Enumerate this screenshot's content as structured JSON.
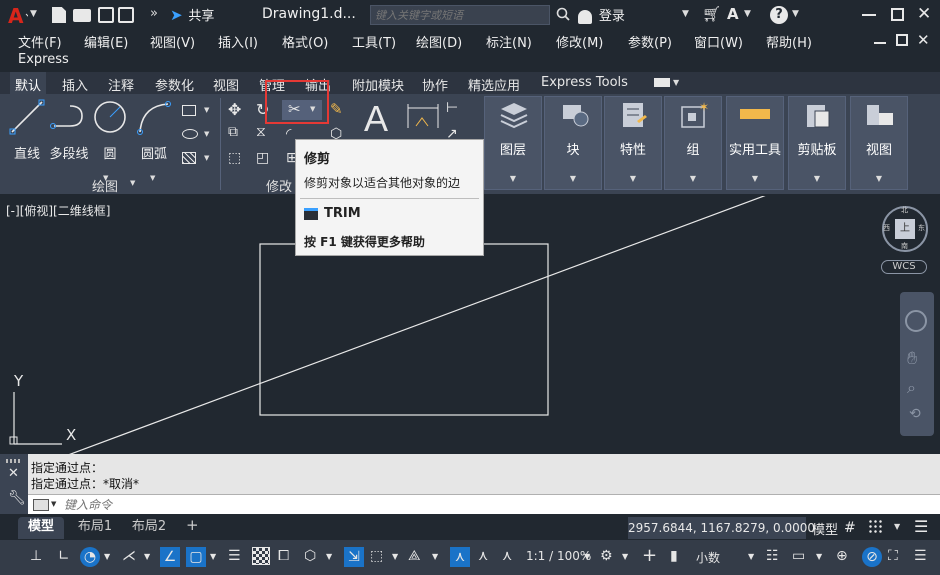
{
  "title_bar": {
    "share_label": "共享",
    "document_title": "Drawing1.d...",
    "search_placeholder": "键入关键字或短语",
    "login_label": "登录"
  },
  "menus": [
    "文件(F)",
    "编辑(E)",
    "视图(V)",
    "插入(I)",
    "格式(O)",
    "工具(T)",
    "绘图(D)",
    "标注(N)",
    "修改(M)",
    "参数(P)",
    "窗口(W)",
    "帮助(H)"
  ],
  "menu_extra": "Express",
  "ribbon_tabs": [
    "默认",
    "插入",
    "注释",
    "参数化",
    "视图",
    "管理",
    "输出",
    "附加模块",
    "协作",
    "精选应用",
    "Express Tools"
  ],
  "draw_panel": {
    "tools": [
      "直线",
      "多段线",
      "圆",
      "圆弧"
    ],
    "label": "绘图"
  },
  "modify_panel": {
    "label": "修改"
  },
  "ribbon_buttons": [
    "图层",
    "块",
    "特性",
    "组",
    "实用工具",
    "剪贴板",
    "视图"
  ],
  "tooltip": {
    "title": "修剪",
    "description": "修剪对象以适合其他对象的边",
    "command": "TRIM",
    "help": "按 F1 键获得更多帮助"
  },
  "viewport_label": "[-][俯视][二维线框]",
  "viewcube": {
    "face": "上",
    "north": "北",
    "south": "南",
    "west": "西",
    "east": "东",
    "wcs": "WCS"
  },
  "ucs": {
    "y": "Y",
    "x": "X"
  },
  "command_history": [
    "指定通过点：",
    "指定通过点：*取消*"
  ],
  "command_placeholder": "键入命令",
  "layout_tabs": [
    "模型",
    "布局1",
    "布局2"
  ],
  "status": {
    "coordinates": "2957.6844, 1167.8279, 0.0000",
    "model_label": "模型",
    "scale": "1:1 / 100%",
    "units": "小数"
  },
  "colors": {
    "accent": "#1a73c8",
    "highlight_box": "#e53935",
    "app_logo": "#d7261b"
  }
}
